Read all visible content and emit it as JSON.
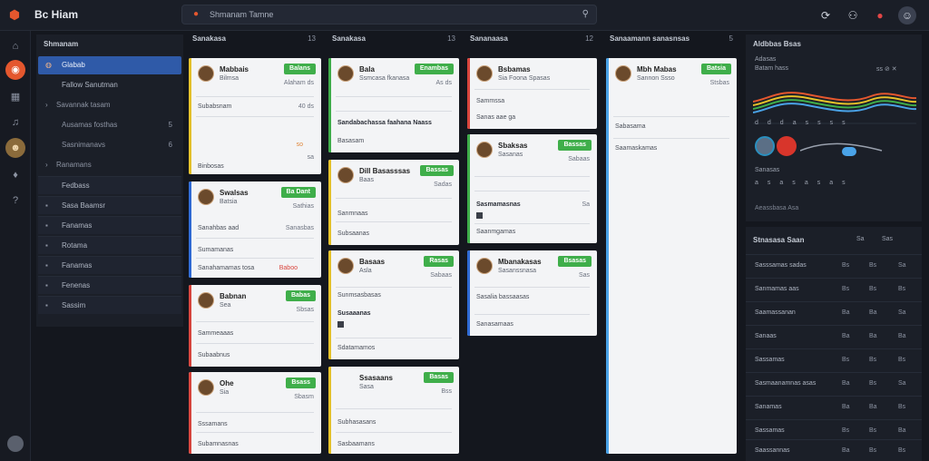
{
  "topbar": {
    "logo_icon": "app-logo-icon",
    "title": "Bc Hiam",
    "search_text": "Shmanam Tamne",
    "icons": [
      "refresh-icon",
      "users-icon",
      "notifications-icon",
      "profile-icon"
    ]
  },
  "rail": {
    "items": [
      "home-icon",
      "orange-active-icon",
      "calendar-icon",
      "bell-icon",
      "user-avatar",
      "chart-icon",
      "help-icon"
    ]
  },
  "sidebar": {
    "header": "Shmanam",
    "items": [
      {
        "label": "Glabab",
        "count": ""
      },
      {
        "label": "Fallow Sanutman",
        "count": ""
      },
      {
        "label": "Savannak tasam",
        "count": ""
      },
      {
        "label": "Ausamas fosthas",
        "count": "5"
      },
      {
        "label": "Sasnimanavs",
        "count": "6"
      },
      {
        "label": "Ranamans",
        "count": ""
      },
      {
        "label": "Fedbass",
        "count": ""
      },
      {
        "label": "Sasa Baamsr",
        "count": ""
      },
      {
        "label": "Fanamas",
        "count": ""
      },
      {
        "label": "Rotama",
        "count": ""
      },
      {
        "label": "Fanamas",
        "count": ""
      },
      {
        "label": "Fenenas",
        "count": ""
      },
      {
        "label": "Sassim",
        "count": ""
      }
    ]
  },
  "columns": [
    {
      "title": "Sanakasa",
      "count": "13"
    },
    {
      "title": "Sanakasa",
      "count": "13"
    },
    {
      "title": "Sananaasa",
      "count": "12"
    },
    {
      "title": "Sanaamann sanasnsas",
      "count": "5"
    }
  ],
  "cards": {
    "c1a": {
      "name": "Mabbais",
      "sub": "Bilmsa",
      "tag": "Balans",
      "meta": "Alaham ds",
      "line1": "Subabsnam",
      "line1r": "40 ds",
      "line2r": "so",
      "line3": "Binbosas",
      "line3r": "sa",
      "color": "#e6c229"
    },
    "c1b": {
      "name": "Swalsas",
      "sub": "Batsia",
      "tag": "Ba Dant",
      "meta": "Sathias",
      "line1": "Sanahbas aad",
      "line1r": "Sanasbas",
      "line2": "Sumamanas",
      "line3": "Sanahamamas tosa",
      "line3r": "Baboo",
      "color": "#2f6bd6"
    },
    "c1c": {
      "name": "Babnan",
      "sub": "Sea",
      "tag": "Babas",
      "meta": "Sbsas",
      "line1": "Sammeaaas",
      "line2": "Subaabnus",
      "color": "#d9453d"
    },
    "c1d": {
      "name": "Ohe",
      "sub": "Sia",
      "tag": "Bsass",
      "meta": "Sbasm",
      "line1": "Sssamans",
      "line2": "Subamnasnas",
      "color": "#d9453d"
    },
    "c2a": {
      "name": "Bala",
      "sub": "Ssmcasa fkanasa",
      "tag": "Enambas",
      "meta": "As ds",
      "line1": "Sandabachassa faahana Naass",
      "line2": "Basasam",
      "color": "#3fae4a"
    },
    "c2b": {
      "name": "Dill Basasssas",
      "sub": "Baas",
      "tag": "Bassas",
      "meta": "Sadas",
      "line1": "Sanmnaas",
      "line2": "Subsaanas",
      "color": "#e6c229"
    },
    "c2c": {
      "name": "Basaas",
      "sub": "Asla",
      "tag": "Rasas",
      "meta": "Sabaas",
      "line1": "Sunmsasbasas",
      "line2": "Susaaanas",
      "line3": "Sdatamamos",
      "color": "#e6c229"
    },
    "c2d": {
      "name": "Ssasaans",
      "sub": "Sasa",
      "tag": "Basas",
      "meta": "Bss",
      "line1": "Subhasasans",
      "line2": "Sasbaamans",
      "color": "#e6c229"
    },
    "c3a": {
      "name": "Bsbamas",
      "sub": "Sia Foona Spasas",
      "line1": "Sammssa",
      "line2": "Sanas aae ga",
      "color": "#d9453d"
    },
    "c3b": {
      "name": "Sbaksas",
      "sub": "Sasanas",
      "tag": "Bassas",
      "meta": "Sabaas",
      "line1": "Sasmamasnas",
      "line1r": "Sa",
      "line2": "Saanmgamas",
      "color": "#3fae4a"
    },
    "c3c": {
      "name": "Mbanakasas",
      "sub": "Sasanssnasa",
      "tag": "Bsasas",
      "meta": "Sas",
      "line1": "Sasalia bassaasas",
      "line2": "Sanasamaas",
      "color": "#2f6bd6"
    },
    "c4a": {
      "name": "Mbh Mabas",
      "sub": "Sannon Ssso",
      "tag": "Batsia",
      "meta": "Stsbas",
      "line1": "Sabasama",
      "line2": "Saamaskamas",
      "color": "#4aa3e8"
    }
  },
  "rpanel": {
    "title": "Aldbbas Bsas",
    "label1": "Adasas",
    "label2": "Batam hass",
    "row1": [
      "dd",
      "da",
      "ss",
      "ss",
      "ss",
      "ss",
      "ss",
      "bs"
    ],
    "label3": "Sanasas",
    "row2": [
      "as",
      "as",
      "as",
      "as",
      "as",
      "as",
      "as",
      "bs"
    ],
    "footer": "Aeassbasa Asa"
  },
  "rtable": {
    "title": "Stnasasa Saan",
    "headers": [
      "Sa",
      "Sas"
    ],
    "rows": [
      [
        "Sasssamas sadas",
        "Bs",
        "Bs",
        "Sa"
      ],
      [
        "Sanmamas aas",
        "Bs",
        "Bs",
        "Bs"
      ],
      [
        "Saamassanan",
        "Ba",
        "Ba",
        "Sa"
      ],
      [
        "Sanaas",
        "Ba",
        "Ba",
        "Ba"
      ],
      [
        "Sassamas",
        "Bs",
        "Bs",
        "Bs"
      ],
      [
        "Sasmaanamnas asas",
        "Ba",
        "Bs",
        "Sa"
      ],
      [
        "Sanamas",
        "Ba",
        "Ba",
        "Bs"
      ],
      [
        "Sassamas",
        "Bs",
        "Bs",
        "Ba"
      ],
      [
        "Saassannas",
        "Ba",
        "Bs",
        "Bs"
      ],
      [
        "Sasas",
        "Ba",
        "Ba",
        "Ba"
      ]
    ]
  }
}
